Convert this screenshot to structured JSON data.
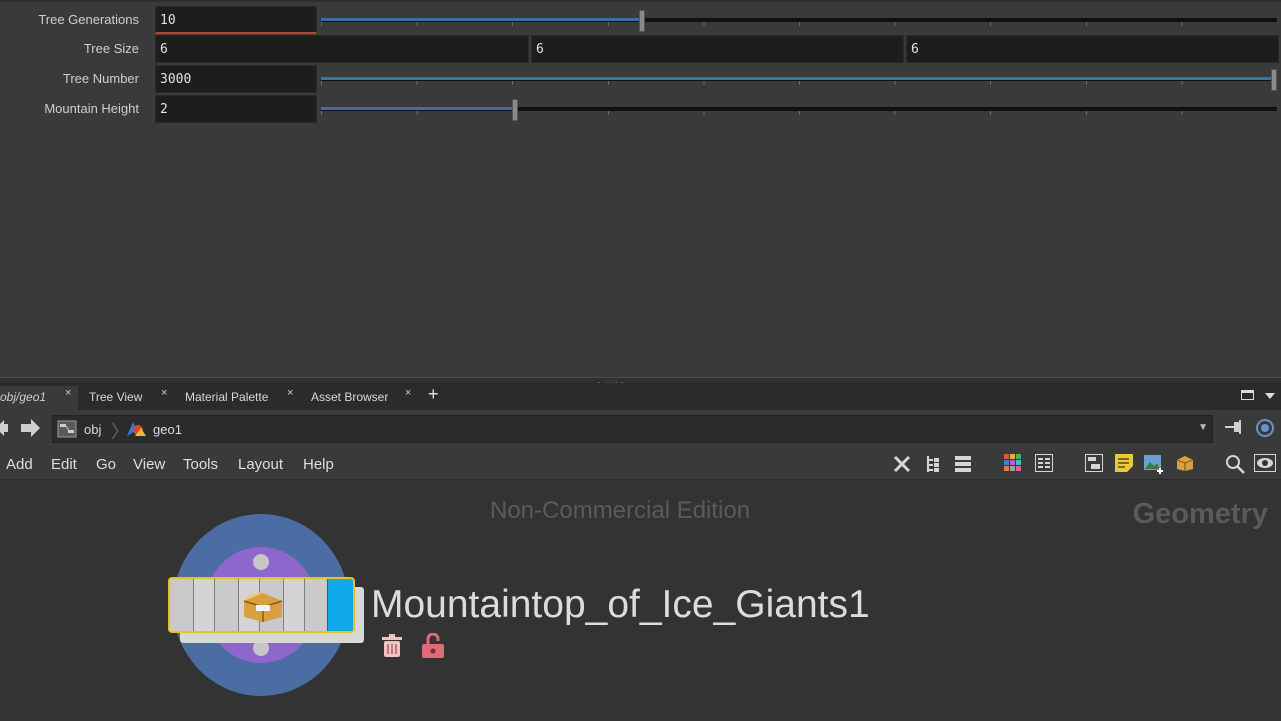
{
  "params": [
    {
      "label": "Tree Generations",
      "value": "10",
      "fill_fraction": 0.333
    },
    {
      "label": "Tree Size",
      "values": [
        "6",
        "6",
        "6"
      ]
    },
    {
      "label": "Tree Number",
      "value": "3000",
      "fill_fraction": 1.0
    },
    {
      "label": "Mountain Height",
      "value": "2",
      "fill_fraction": 0.2
    }
  ],
  "tabs": [
    {
      "label": "obj/geo1",
      "active": true
    },
    {
      "label": "Tree View"
    },
    {
      "label": "Material Palette"
    },
    {
      "label": "Asset Browser"
    }
  ],
  "tab_close_glyph": "×",
  "tab_add_glyph": "+",
  "path": {
    "crumbs": [
      {
        "label": "obj",
        "icon": "network-icon"
      },
      {
        "label": "geo1",
        "icon": "geometry-node-icon"
      }
    ]
  },
  "menu": [
    "Add",
    "Edit",
    "Go",
    "View",
    "Tools",
    "Layout",
    "Help"
  ],
  "toolbar_icons": [
    "wrench-icon",
    "tree-icon",
    "list-icon",
    "color-grid-icon",
    "grid-icon",
    "network-box-icon",
    "sticky-note-icon",
    "image-icon",
    "asset-icon",
    "search-icon",
    "eye-icon"
  ],
  "network": {
    "watermark": "Non-Commercial Edition",
    "context": "Geometry",
    "node_name": "Mountaintop_of_Ice_Giants1"
  },
  "colors": {
    "accent_blue": "#3f6ea6",
    "node_selected_outline": "#e6c21c",
    "node_flag": "#10a9ea",
    "ring_outer": "#4c6da3",
    "ring_inner": "#8d67cc",
    "badge_red": "#e06a78"
  }
}
